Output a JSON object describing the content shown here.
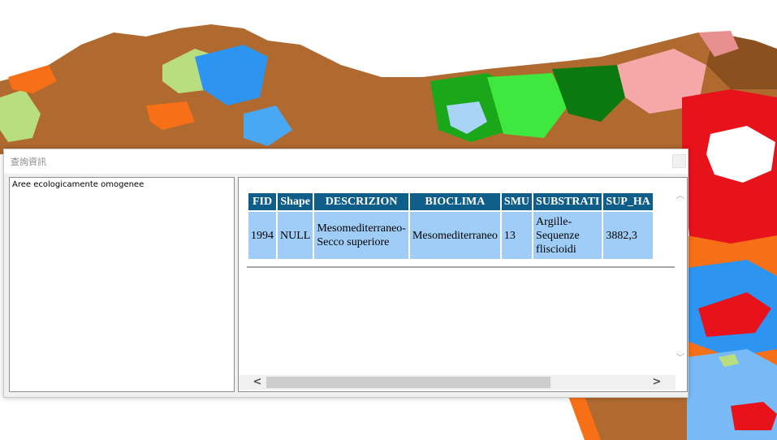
{
  "window": {
    "title": "查詢資訊"
  },
  "layers": [
    "Aree ecologicamente omogenee"
  ],
  "table": {
    "columns": [
      "FID",
      "Shape",
      "DESCRIZION",
      "BIOCLIMA",
      "SMU",
      "SUBSTRATI",
      "SUP_HA"
    ],
    "rows": [
      [
        "1994",
        "NULL",
        "Mesomediterraneo-\nSecco superiore",
        "Mesomediterraneo",
        "13",
        "Argille-\nSequenze\nfliscioidi",
        "3882,3"
      ]
    ]
  },
  "scrollbars": {
    "up_glyph": "︿",
    "down_glyph": "﹀",
    "left_glyph": "<",
    "right_glyph": ">"
  },
  "colors": {
    "header_bg": "#0f5e8a",
    "cell_bg": "#9fcdf7"
  },
  "icons": {
    "close": "close-icon"
  }
}
